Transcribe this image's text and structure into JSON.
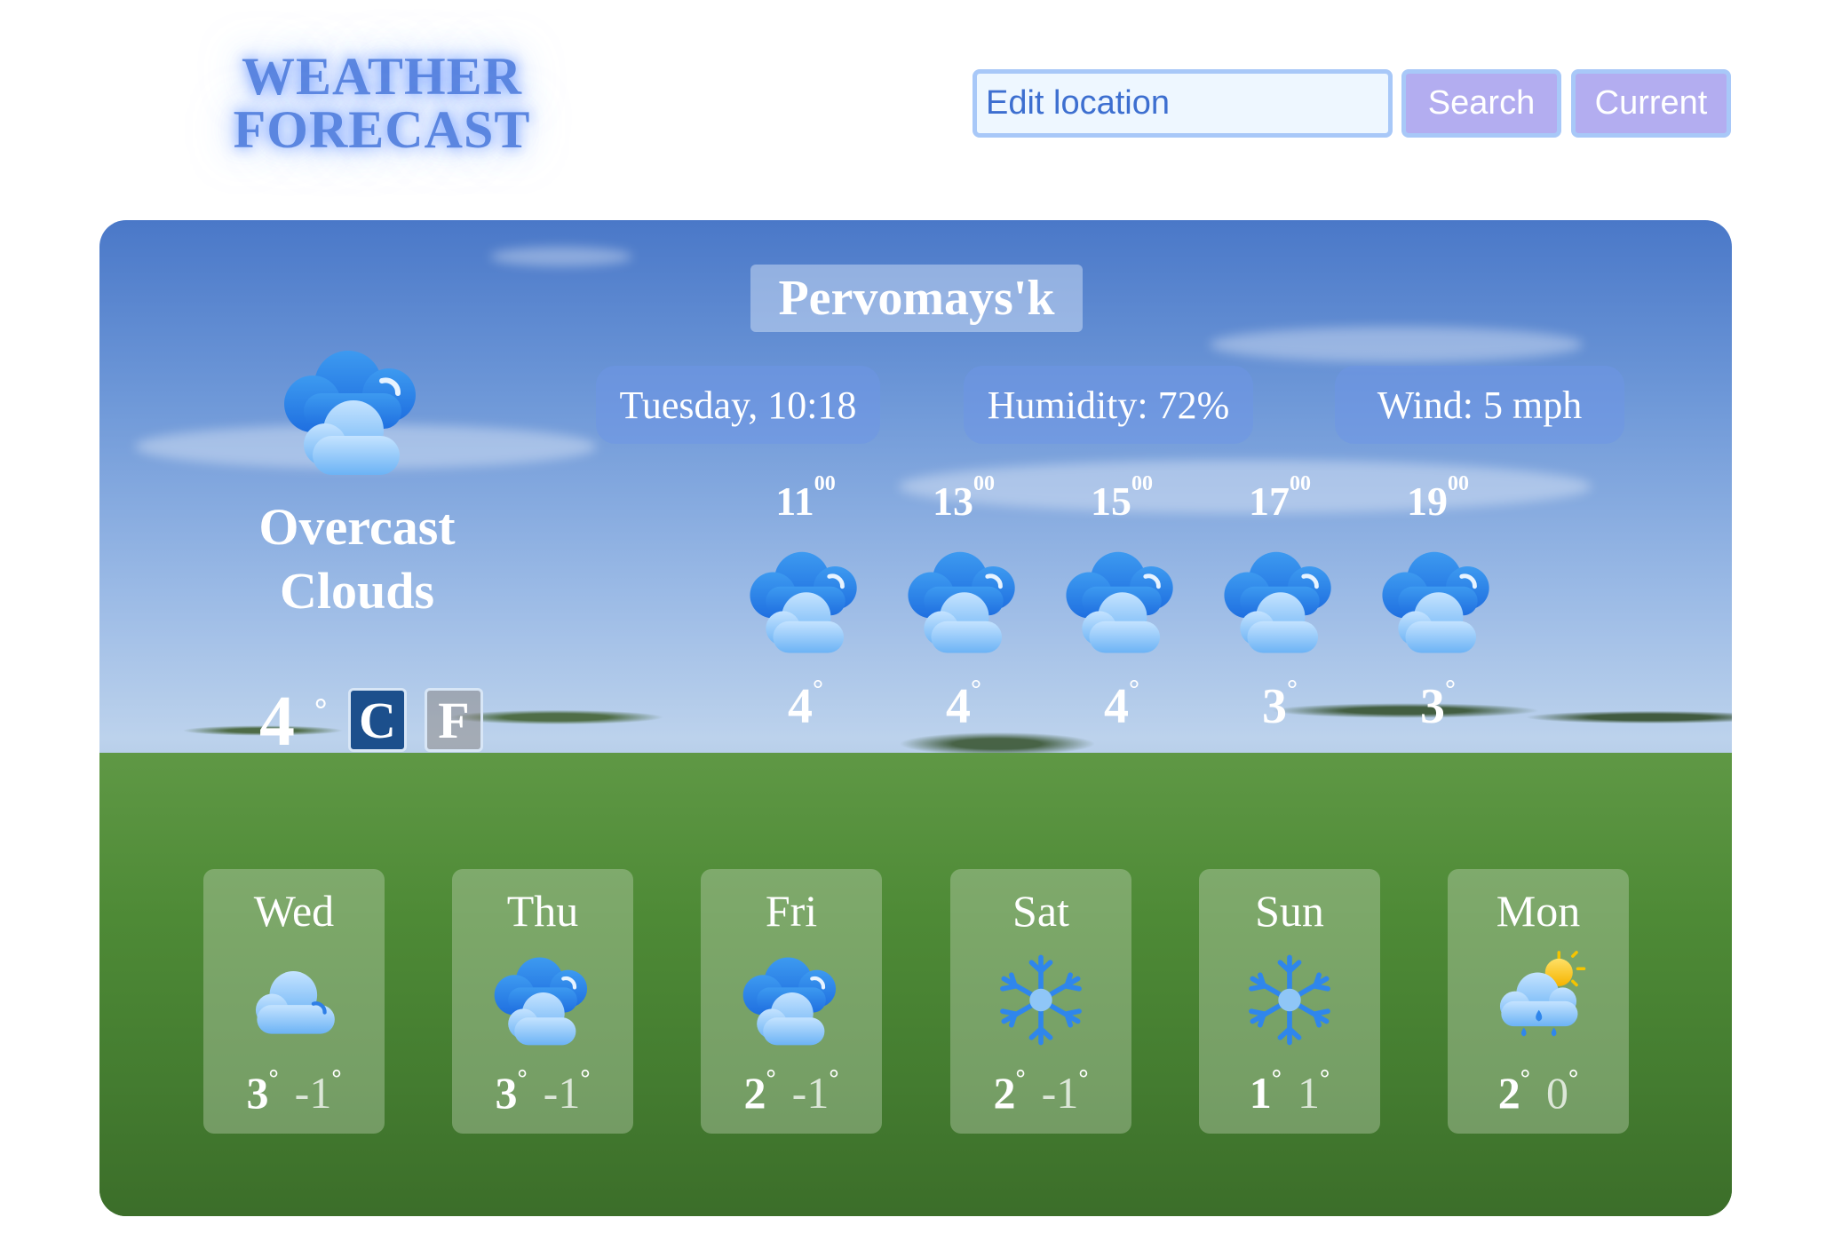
{
  "header": {
    "logo_line1": "WEATHER",
    "logo_line2": "FORECAST",
    "search_placeholder": "Edit location",
    "search_button": "Search",
    "current_button": "Current"
  },
  "location": {
    "city": "Pervomays'k"
  },
  "info": {
    "datetime": "Tuesday, 10:18",
    "humidity": "Humidity: 72%",
    "wind": "Wind: 5 mph"
  },
  "current": {
    "icon": "overcast-clouds-icon",
    "description": "Overcast Clouds",
    "temperature": "4",
    "degree": "°",
    "unit_c": "C",
    "unit_f": "F",
    "active_unit": "C"
  },
  "hourly": [
    {
      "hour": "11",
      "minutes": "00",
      "icon": "overcast-clouds-icon",
      "temp": "4",
      "deg": "°"
    },
    {
      "hour": "13",
      "minutes": "00",
      "icon": "overcast-clouds-icon",
      "temp": "4",
      "deg": "°"
    },
    {
      "hour": "15",
      "minutes": "00",
      "icon": "overcast-clouds-icon",
      "temp": "4",
      "deg": "°"
    },
    {
      "hour": "17",
      "minutes": "00",
      "icon": "overcast-clouds-icon",
      "temp": "3",
      "deg": "°"
    },
    {
      "hour": "19",
      "minutes": "00",
      "icon": "overcast-clouds-icon",
      "temp": "3",
      "deg": "°"
    }
  ],
  "daily": [
    {
      "day": "Wed",
      "icon": "cloud-icon",
      "high": "3",
      "low": "-1",
      "deg": "°"
    },
    {
      "day": "Thu",
      "icon": "overcast-clouds-icon",
      "high": "3",
      "low": "-1",
      "deg": "°"
    },
    {
      "day": "Fri",
      "icon": "overcast-clouds-icon",
      "high": "2",
      "low": "-1",
      "deg": "°"
    },
    {
      "day": "Sat",
      "icon": "snowflake-icon",
      "high": "2",
      "low": "-1",
      "deg": "°"
    },
    {
      "day": "Sun",
      "icon": "snowflake-icon",
      "high": "1",
      "low": "1",
      "deg": "°"
    },
    {
      "day": "Mon",
      "icon": "sun-cloud-rain-icon",
      "high": "2",
      "low": "0",
      "deg": "°"
    }
  ],
  "colors": {
    "accent": "#5b86e0",
    "button_bg": "#b3adf0",
    "input_border": "#a8c8f8",
    "active_unit_bg": "#1c4f8c"
  }
}
